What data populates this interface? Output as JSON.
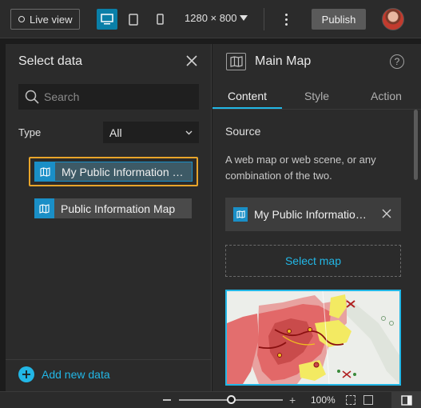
{
  "toolbar": {
    "live_view_label": "Live view",
    "resolution": "1280 × 800",
    "publish_label": "Publish",
    "devices": [
      "desktop",
      "tablet",
      "phone"
    ],
    "active_device": "desktop"
  },
  "select_data_panel": {
    "title": "Select data",
    "search_placeholder": "Search",
    "type_label": "Type",
    "type_value": "All",
    "items": [
      {
        "label": "My Public Information Map",
        "selected": true
      },
      {
        "label": "Public Information Map",
        "selected": false
      }
    ],
    "add_new_label": "Add new data"
  },
  "settings_panel": {
    "title": "Main Map",
    "tabs": [
      {
        "label": "Content",
        "active": true
      },
      {
        "label": "Style",
        "active": false
      },
      {
        "label": "Action",
        "active": false
      }
    ],
    "source_label": "Source",
    "source_description": "A web map or web scene, or any combination of the two.",
    "selected_source": "My Public Information Map",
    "select_map_label": "Select map"
  },
  "statusbar": {
    "zoom_percent": "100%",
    "zoom_fraction": 0.5
  },
  "colors": {
    "accent": "#22b7e6",
    "selection_outline": "#e8a52a",
    "map_item_icon": "#1a8fc7"
  }
}
